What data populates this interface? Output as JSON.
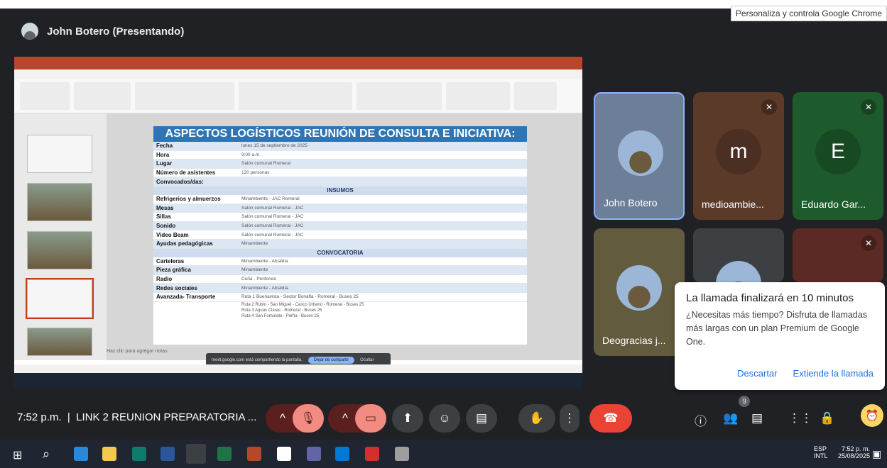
{
  "tooltip": "Personaliza y controla Google Chrome",
  "presenter": {
    "label": "John Botero (Presentando)"
  },
  "slide": {
    "title": "ASPECTOS LOGÍSTICOS REUNIÓN DE CONSULTA E INICIATIVA:",
    "rows": [
      {
        "k": "Fecha",
        "v": "lunes 15 de septiembre de 2025"
      },
      {
        "k": "Hora",
        "v": "9:00 a.m."
      },
      {
        "k": "Lugar",
        "v": "Salón comunal Romeral"
      },
      {
        "k": "Número de asistentes",
        "v": "120 personas"
      },
      {
        "k": "Convocados/das:",
        "v": ""
      }
    ],
    "insumos_title": "INSUMOS",
    "insumos": [
      {
        "k": "Refrigerios y almuerzos",
        "v": "Minambiente - JAC Romeral"
      },
      {
        "k": "Mesas",
        "v": "Salón comunal Romeral - JAC"
      },
      {
        "k": "Sillas",
        "v": "Salón comunal Romeral - JAC"
      },
      {
        "k": "Sonido",
        "v": "Salón comunal Romeral - JAC"
      },
      {
        "k": "Video Beam",
        "v": "Salón comunal Romeral - JAC"
      },
      {
        "k": "Ayudas pedagógicas",
        "v": "Minambiente"
      }
    ],
    "convocatoria_title": "CONVOCATORIA",
    "convocatoria": [
      {
        "k": "Carteleras",
        "v": "Minambiente - Alcaldía"
      },
      {
        "k": "Pieza gráfica",
        "v": "Minambiente"
      },
      {
        "k": "Radio",
        "v": "Cuña - Perifoneo"
      },
      {
        "k": "Redes sociales",
        "v": "Minambiente - Alcaldía"
      },
      {
        "k": "Avanzada- Transporte",
        "v": "Ruta 1 Buenavista - Sector Bonafla - Romeral - Buses 25"
      }
    ],
    "rutas": [
      "Ruta 2 Rubio - San Miguel - Casco Urbano - Romeral - Buses 25",
      "Ruta 3 Aguas Claras - Romeral - Buses 25",
      "Ruta 4 San Fortunato - Porfía - Buses 25"
    ],
    "notes_placeholder": "Haz clic para agregar notas",
    "share_text": "meet.google.com está compartiendo la pantalla.",
    "stop_share": "Dejar de compartir",
    "hide": "Ocultar"
  },
  "participants": [
    {
      "name": "John Botero",
      "initial": ""
    },
    {
      "name": "medioambie...",
      "initial": "m",
      "color": "#5b3a29"
    },
    {
      "name": "Eduardo Gar...",
      "initial": "E",
      "color": "#1e5b2c"
    },
    {
      "name": "Deogracias j...",
      "initial": ""
    }
  ],
  "toast": {
    "title": "La llamada finalizará en 10 minutos",
    "body": "¿Necesitas más tiempo? Disfruta de llamadas más largas con un plan Premium de Google One.",
    "dismiss": "Descartar",
    "extend": "Extiende la llamada"
  },
  "meeting": {
    "time": "7:52 p.m.",
    "separator": "|",
    "name": "LINK 2 REUNION PREPARATORIA ...",
    "people_badge": "9"
  },
  "taskbar": {
    "lang1": "ESP",
    "lang2": "INTL",
    "clock": "7:52 p. m.",
    "date": "25/08/2025"
  }
}
